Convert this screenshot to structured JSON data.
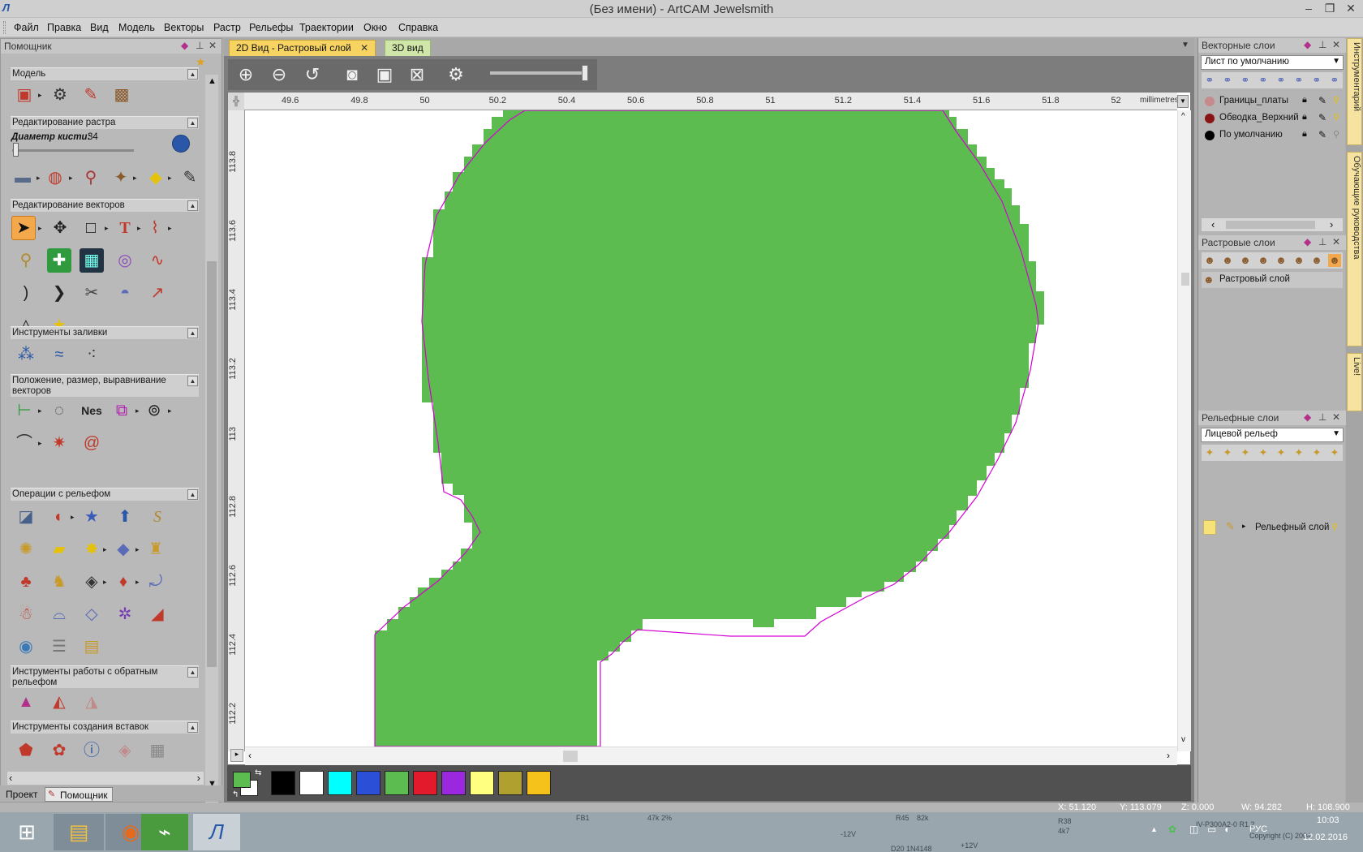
{
  "window": {
    "title": "(Без имени) - ArtCAM Jewelsmith",
    "app_icon": "artcam-logo-icon",
    "buttons": [
      "minimize",
      "restore",
      "close"
    ]
  },
  "menu": [
    "Файл",
    "Правка",
    "Вид",
    "Модель",
    "Векторы",
    "Растр",
    "Рельефы",
    "Траектории",
    "Окно",
    "Справка"
  ],
  "left_panel": {
    "title": "Помощник",
    "brush_label": "Диаметр кисти:",
    "brush_value": "34",
    "sections": {
      "model": "Модель",
      "raster": "Редактирование растра",
      "vectors": "Редактирование векторов",
      "fill": "Инструменты заливки",
      "position": "Положение, размер, выравнивание векторов",
      "relief_ops": "Операции с рельефом",
      "reverse": "Инструменты работы с обратным рельефом",
      "inserts": "Инструменты создания вставок"
    },
    "tabs": [
      "Проект",
      "Помощник"
    ]
  },
  "document": {
    "tabs": [
      "2D Вид - Растровый слой",
      "3D вид"
    ],
    "active_tab": 0,
    "units": "millimetres",
    "h_ruler": [
      "49.6",
      "49.8",
      "50",
      "50.2",
      "50.4",
      "50.6",
      "50.8",
      "51",
      "51.2",
      "51.4",
      "51.6",
      "51.8",
      "52"
    ],
    "v_ruler": [
      "113.8",
      "113.6",
      "113.4",
      "113.2",
      "113",
      "112.8",
      "112.6",
      "112.4",
      "112.2"
    ],
    "raster_fill_color": "#5cbc50",
    "vector_outline_color": "#d400d4"
  },
  "palette": {
    "primary": "#5cbc50",
    "secondary": "#ffffff",
    "swatches": [
      "#000000",
      "#ffffff",
      "#00ffff",
      "#2b4fd6",
      "#5cbc50",
      "#e31a2b",
      "#9b28e0",
      "#ffff80",
      "#b0a030",
      "#f5c21c"
    ]
  },
  "right_panel": {
    "vector_layers": {
      "title": "Векторные слои",
      "sheet": "Лист по умолчанию",
      "layers": [
        {
          "name": "Границы_платы",
          "color": "#c78a8a"
        },
        {
          "name": "Обводка_Верхний",
          "color": "#8a1414"
        },
        {
          "name": "По умолчанию",
          "color": "#000000"
        }
      ]
    },
    "raster_layers": {
      "title": "Растровые слои",
      "layers": [
        "Растровый слой"
      ]
    },
    "relief_layers": {
      "title": "Рельефные слои",
      "relief": "Лицевой рельеф",
      "layers": [
        "Рельефный слой"
      ]
    }
  },
  "side_tabs": [
    "Инструментарий",
    "Обучающие руководства",
    "Live!"
  ],
  "status": {
    "x": "X: 51.120",
    "y": "Y: 113.079",
    "z": "Z: 0.000",
    "w": "W: 94.282",
    "h": "H: 108.900"
  },
  "taskbar": {
    "apps": [
      "windows-start-icon",
      "file-explorer-icon",
      "firefox-icon",
      "pcb-app-icon",
      "artcam-icon"
    ],
    "lang": "РУС",
    "time": "10:03",
    "date": "12.02.2016",
    "bg_text": [
      "FB1",
      "47k 2%",
      "R45",
      "82k",
      "R38",
      "4k7",
      "-12V",
      "+12V",
      "D20 1N4148",
      "IV-P300A2-0 R1.2",
      "Copyright (C) 2004"
    ]
  }
}
